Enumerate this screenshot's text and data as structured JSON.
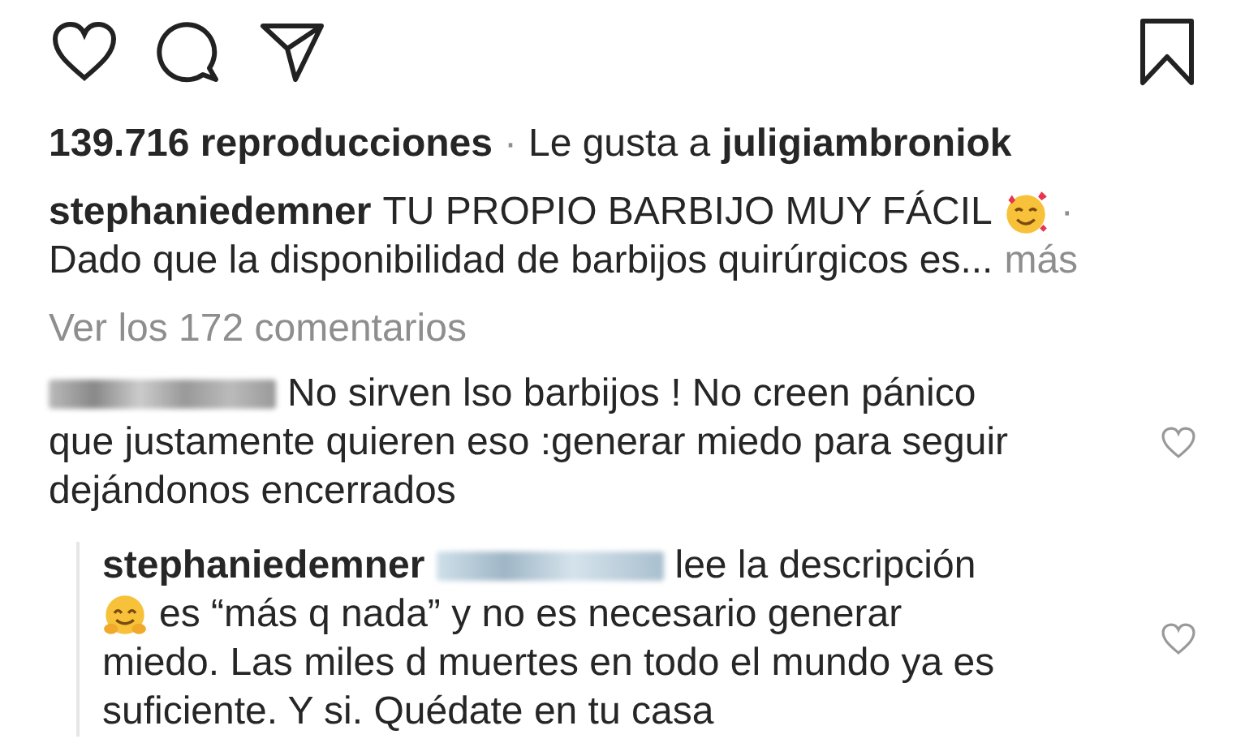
{
  "stats": {
    "views": "139.716 reproducciones",
    "separator": "·",
    "liked_prefix": "Le gusta a",
    "liked_by": "juligiambroniok"
  },
  "caption": {
    "username": "stephaniedemner",
    "title": "TU PROPIO BARBIJO MUY FÁCIL",
    "separator": "·",
    "text": "Dado que la disponibilidad de barbijos quirúrgicos es...",
    "more": "más"
  },
  "view_comments": "Ver los 172 comentarios",
  "comments": [
    {
      "username_hidden": true,
      "lines": [
        "No sirven lso barbijos ! No creen pánico",
        "que justamente quieren eso :generar miedo para seguir",
        "dejándonos encerrados"
      ],
      "liked": false,
      "replies": [
        {
          "username": "stephaniedemner",
          "mention_hidden": true,
          "lines": [
            "lee la descripción",
            "es “más q nada” y no es necesario generar",
            "miedo. Las miles d muertes en todo el mundo ya es",
            "suficiente. Y si. Quédate en tu casa"
          ],
          "liked": false
        }
      ]
    }
  ],
  "saved": false
}
